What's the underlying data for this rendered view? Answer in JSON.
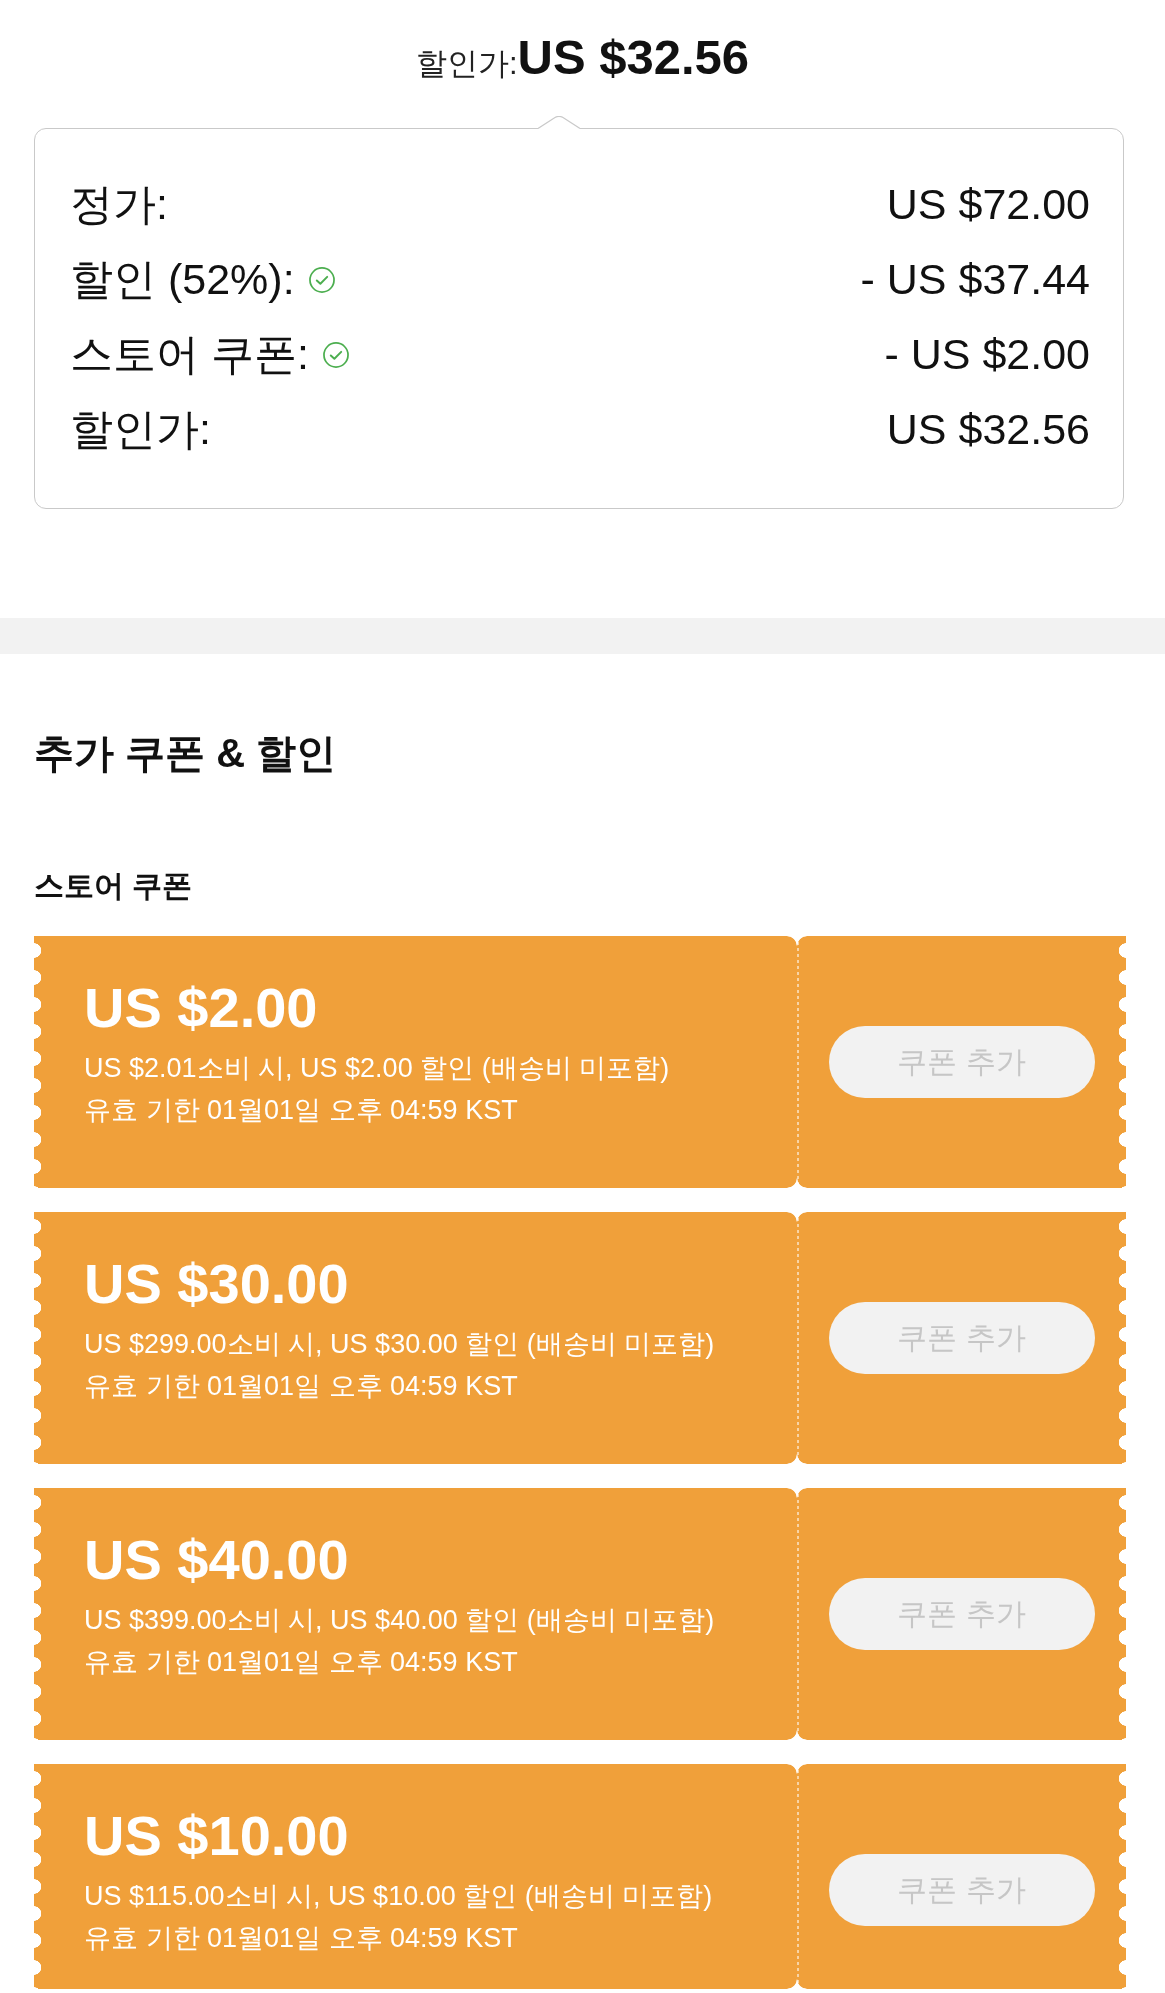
{
  "price_header": {
    "label": "할인가:",
    "price": "US $32.56"
  },
  "price_breakdown": {
    "rows": [
      {
        "label": "정가:",
        "value": "US $72.00",
        "applied": false
      },
      {
        "label": "할인 (52%):",
        "value": "- US $37.44",
        "applied": true
      },
      {
        "label": "스토어 쿠폰:",
        "value": "- US $2.00",
        "applied": true
      },
      {
        "label": "할인가:",
        "value": "US $32.56",
        "applied": false
      }
    ]
  },
  "additional_coupons": {
    "title": "추가 쿠폰 & 할인",
    "store_coupons": {
      "heading": "스토어 쿠폰",
      "coupons": [
        {
          "amount": "US $2.00",
          "condition": "US $2.01소비 시, US $2.00 할인 (배송비 미포함)",
          "validity": "유효 기한 01월01일 오후 04:59 KST",
          "button": {
            "label": "쿠폰 추가",
            "disabled": true
          }
        },
        {
          "amount": "US $30.00",
          "condition": "US $299.00소비 시, US $30.00 할인 (배송비 미포함)",
          "validity": "유효 기한 01월01일 오후 04:59 KST",
          "button": {
            "label": "쿠폰 추가",
            "disabled": true
          }
        },
        {
          "amount": "US $40.00",
          "condition": "US $399.00소비 시, US $40.00 할인 (배송비 미포함)",
          "validity": "유효 기한 01월01일 오후 04:59 KST",
          "button": {
            "label": "쿠폰 추가",
            "disabled": true
          }
        },
        {
          "amount": "US $10.00",
          "condition": "US $115.00소비 시, US $10.00 할인 (배송비 미포함)",
          "validity": "유효 기한 01월01일 오후 04:59 KST",
          "button": {
            "label": "쿠폰 추가",
            "disabled": true
          }
        }
      ]
    }
  }
}
